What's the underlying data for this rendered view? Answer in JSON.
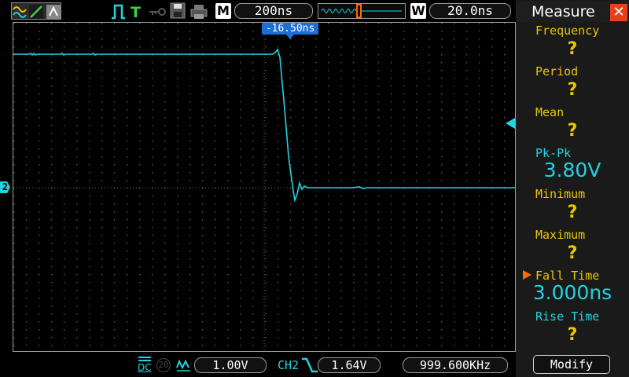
{
  "colors": {
    "trace": "#22d3e0",
    "accent_yellow": "#e9c800",
    "accent_orange": "#ff6a00",
    "close_red": "#e8401a",
    "grid_dots": "#5a5a5a"
  },
  "topbar": {
    "m_label": "M",
    "timebase": "200ns",
    "w_label": "W",
    "window_time": "20.0ns",
    "trigger_position": "-16.50ns",
    "icons": [
      "waveform-icon",
      "edge-icon",
      "usb-icon",
      "pulse-icon",
      "trigger-t-icon",
      "key-icon",
      "save-icon",
      "printer-icon"
    ]
  },
  "channel_marker": "2",
  "measure": {
    "title": "Measure",
    "items": [
      {
        "label": "Frequency",
        "value": "?"
      },
      {
        "label": "Period",
        "value": "?"
      },
      {
        "label": "Mean",
        "value": "?"
      },
      {
        "label": "Pk-Pk",
        "value": "3.80V"
      },
      {
        "label": "Minimum",
        "value": "?"
      },
      {
        "label": "Maximum",
        "value": "?"
      },
      {
        "label": "Fall Time",
        "value": "3.000ns"
      },
      {
        "label": "Rise Time",
        "value": "?"
      }
    ],
    "modify_label": "Modify"
  },
  "bottombar": {
    "coupling": "DC",
    "bw_limit": "20",
    "volts_div": "1.00V",
    "trig_source": "CH2",
    "trig_level": "1.64V",
    "frequency": "999.600KHz"
  }
}
